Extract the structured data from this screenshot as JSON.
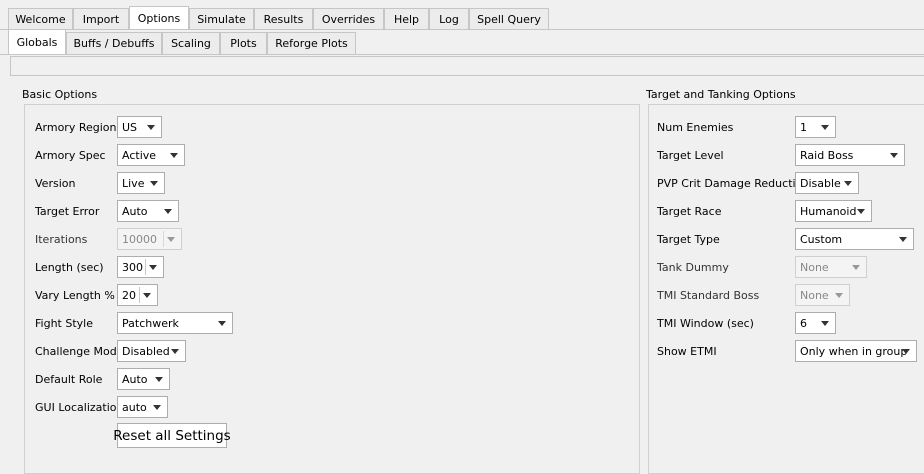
{
  "main_tabs": [
    "Welcome",
    "Import",
    "Options",
    "Simulate",
    "Results",
    "Overrides",
    "Help",
    "Log",
    "Spell Query"
  ],
  "sub_tabs": [
    "Globals",
    "Buffs / Debuffs",
    "Scaling",
    "Plots",
    "Reforge Plots"
  ],
  "basic_options": {
    "title": "Basic Options",
    "rows": [
      {
        "label": "Armory Region",
        "value": "US"
      },
      {
        "label": "Armory Spec",
        "value": "Active"
      },
      {
        "label": "Version",
        "value": "Live"
      },
      {
        "label": "Target Error",
        "value": "Auto"
      },
      {
        "label": "Iterations",
        "value": "10000"
      },
      {
        "label": "Length (sec)",
        "value": "300"
      },
      {
        "label": "Vary Length %",
        "value": "20"
      },
      {
        "label": "Fight Style",
        "value": "Patchwerk"
      },
      {
        "label": "Challenge Mode",
        "value": "Disabled"
      },
      {
        "label": "Default Role",
        "value": "Auto"
      },
      {
        "label": "GUI Localization",
        "value": "auto"
      }
    ],
    "reset_button": "Reset all Settings"
  },
  "target_options": {
    "title": "Target and Tanking Options",
    "rows": [
      {
        "label": "Num Enemies",
        "value": "1"
      },
      {
        "label": "Target Level",
        "value": "Raid Boss"
      },
      {
        "label": "PVP Crit Damage Reduction",
        "value": "Disable"
      },
      {
        "label": "Target Race",
        "value": "Humanoid"
      },
      {
        "label": "Target Type",
        "value": "Custom"
      },
      {
        "label": "Tank Dummy",
        "value": "None"
      },
      {
        "label": "TMI Standard Boss",
        "value": "None"
      },
      {
        "label": "TMI Window (sec)",
        "value": "6"
      },
      {
        "label": "Show ETMI",
        "value": "Only when in group"
      }
    ]
  }
}
